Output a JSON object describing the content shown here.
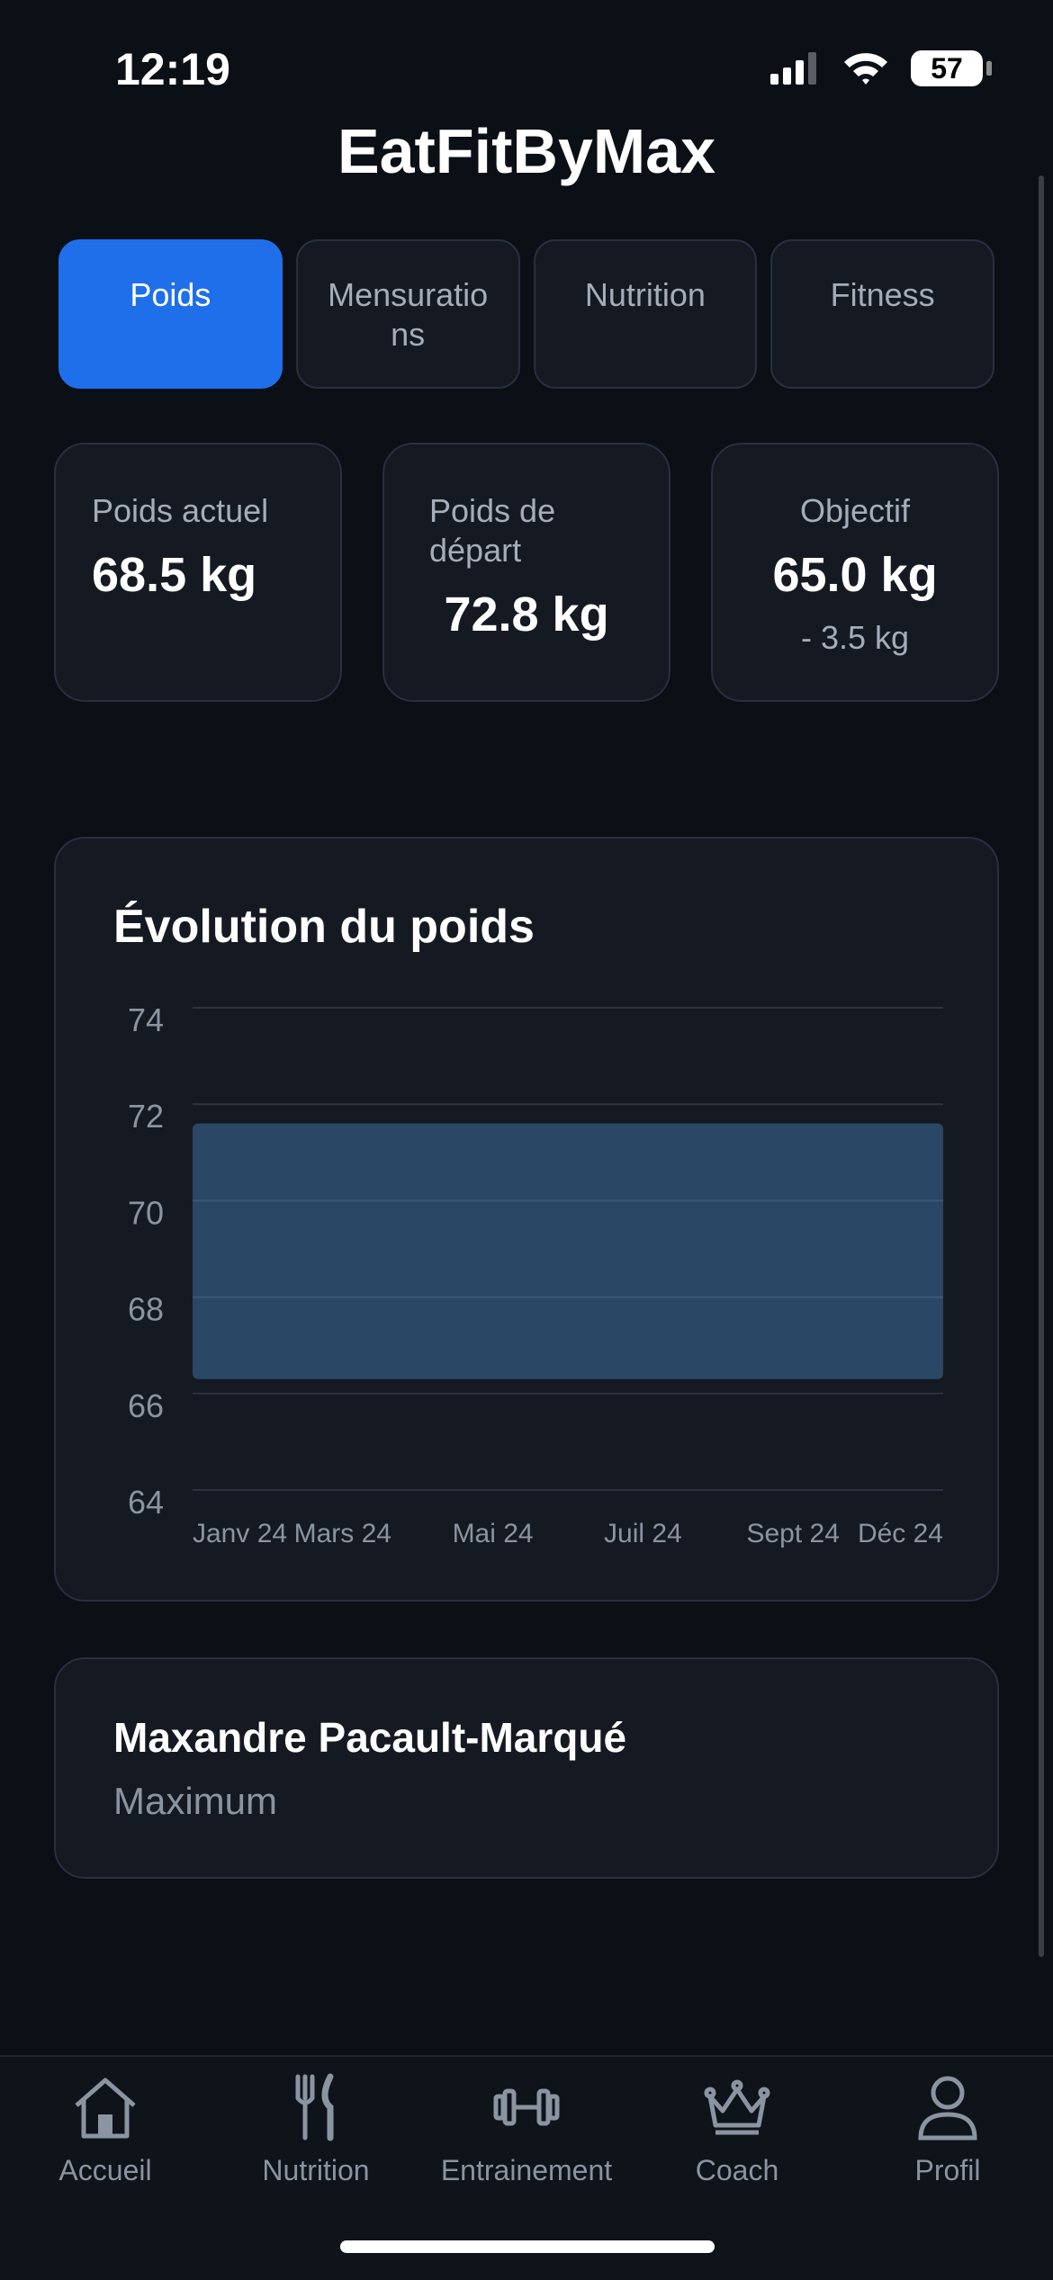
{
  "status": {
    "time": "12:19",
    "battery": "57"
  },
  "app_title": "EatFitByMax",
  "tabs": [
    {
      "label": "Poids"
    },
    {
      "label": "Mensurations"
    },
    {
      "label": "Nutrition"
    },
    {
      "label": "Fitness"
    }
  ],
  "stats": {
    "current": {
      "label": "Poids actuel",
      "value": "68.5 kg"
    },
    "start": {
      "label": "Poids de départ",
      "value": "72.8 kg"
    },
    "goal": {
      "label": "Objectif",
      "value": "65.0 kg",
      "sub": "- 3.5 kg"
    }
  },
  "chart_data": {
    "type": "area",
    "title": "Évolution du poids",
    "categories": [
      "Janv 24",
      "Mars 24",
      "Mai 24",
      "Juil 24",
      "Sept 24",
      "Déc 24"
    ],
    "y_ticks": [
      74,
      72,
      70,
      68,
      66,
      64
    ],
    "ylim": [
      64,
      74
    ],
    "band": {
      "low": 66.3,
      "high": 71.6
    },
    "colors": {
      "fill": "#2a4766",
      "grid": "#2b3240",
      "tick": "#8b94a1"
    }
  },
  "profile": {
    "name": "Maxandre Pacault-Marqué",
    "subtitle": "Maximum"
  },
  "nav": [
    {
      "label": "Accueil",
      "icon": "home-icon"
    },
    {
      "label": "Nutrition",
      "icon": "fork-knife-icon"
    },
    {
      "label": "Entrainement",
      "icon": "dumbbell-icon"
    },
    {
      "label": "Coach",
      "icon": "crown-icon"
    },
    {
      "label": "Profil",
      "icon": "person-icon"
    }
  ]
}
